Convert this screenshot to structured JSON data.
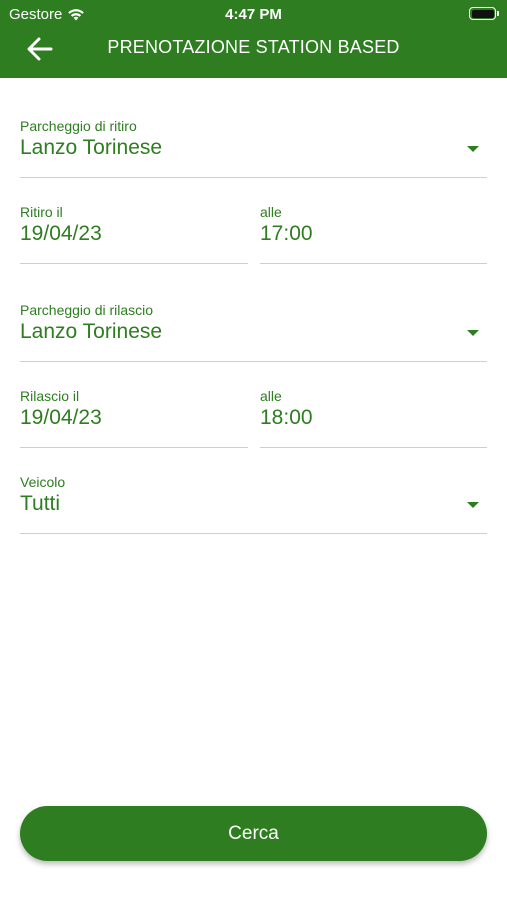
{
  "status_bar": {
    "carrier": "Gestore",
    "time": "4:47 PM"
  },
  "header": {
    "title": "PRENOTAZIONE STATION BASED"
  },
  "form": {
    "pickup_parking": {
      "label": "Parcheggio di ritiro",
      "value": "Lanzo Torinese"
    },
    "pickup_date": {
      "label": "Ritiro il",
      "value": "19/04/23"
    },
    "pickup_time": {
      "label": "alle",
      "value": "17:00"
    },
    "return_parking": {
      "label": "Parcheggio di rilascio",
      "value": "Lanzo Torinese"
    },
    "return_date": {
      "label": "Rilascio il",
      "value": "19/04/23"
    },
    "return_time": {
      "label": "alle",
      "value": "18:00"
    },
    "vehicle": {
      "label": "Veicolo",
      "value": "Tutti"
    }
  },
  "actions": {
    "search_label": "Cerca"
  },
  "colors": {
    "primary": "#2e7d20",
    "divider": "#cfcfcf",
    "background": "#ffffff"
  },
  "icons": {
    "back": "arrow-left-icon",
    "wifi": "wifi-icon",
    "battery": "battery-icon",
    "dropdown": "caret-down-icon"
  }
}
